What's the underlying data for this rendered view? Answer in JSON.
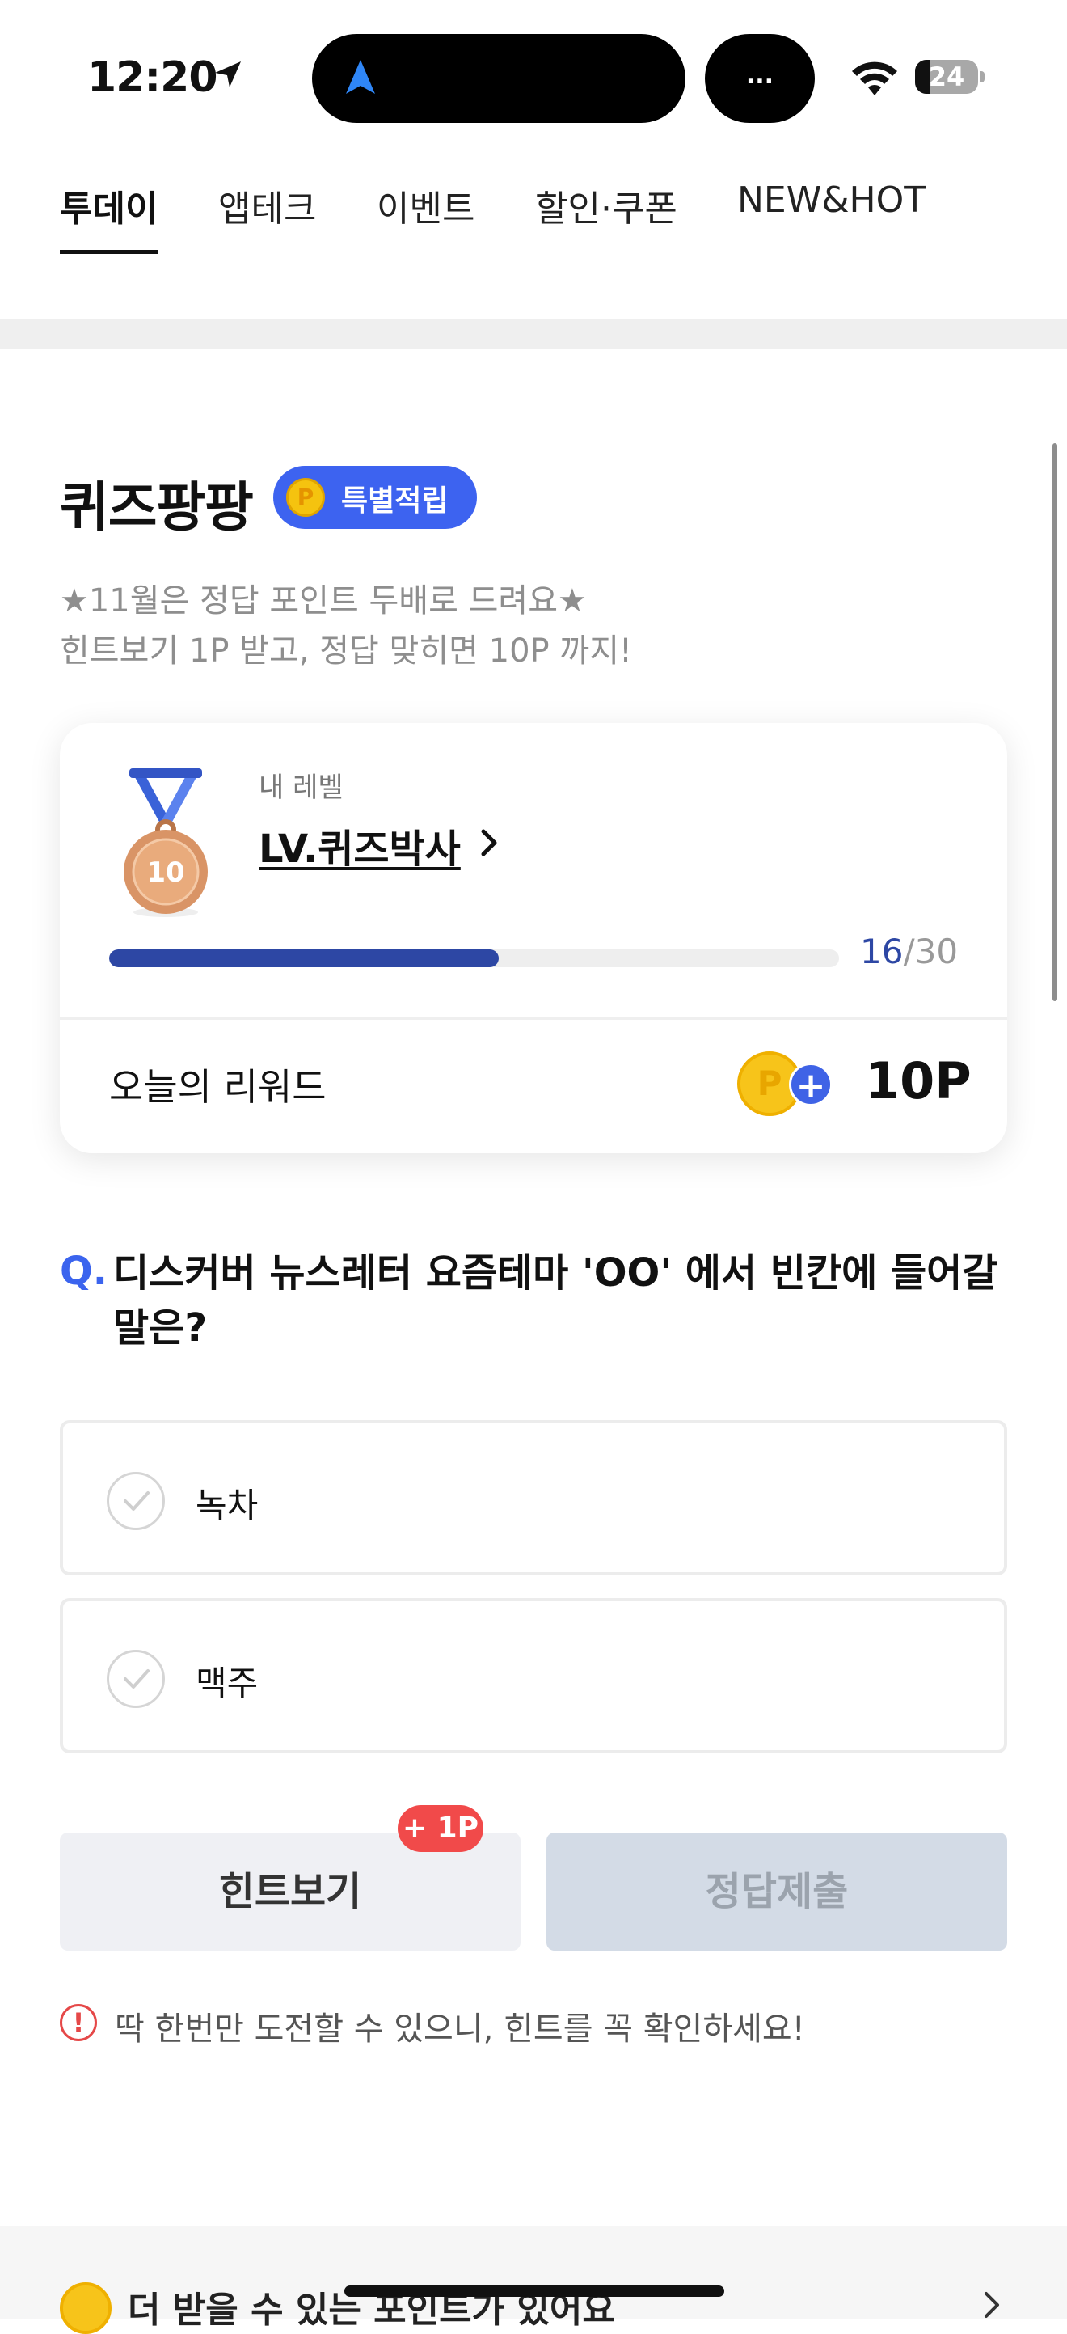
{
  "status_bar": {
    "time": "12:20",
    "island_right_label": "...",
    "battery_level": "24",
    "battery_fraction": 0.24
  },
  "tabs": [
    {
      "label": "투데이",
      "active": true
    },
    {
      "label": "앱테크",
      "active": false
    },
    {
      "label": "이벤트",
      "active": false
    },
    {
      "label": "할인·쿠폰",
      "active": false
    },
    {
      "label": "NEW&HOT",
      "active": false
    }
  ],
  "quiz": {
    "title": "퀴즈팡팡",
    "badge_coin": "P",
    "badge_label": "특별적립",
    "subtitle_line1": "★11월은 정답 포인트 두배로 드려요★",
    "subtitle_line2": "힌트보기 1P 받고, 정답 맞히면 10P 까지!"
  },
  "level_card": {
    "medal_number": "10",
    "label": "내 레벨",
    "level_name": "LV.퀴즈박사",
    "progress_current": "16",
    "progress_separator": "/",
    "progress_total": "30",
    "progress_fraction": 0.5333,
    "reward_label": "오늘의 리워드",
    "reward_coin": "P",
    "reward_plus": "+",
    "reward_value": "10P"
  },
  "question": {
    "marker": "Q.",
    "text": "디스커버 뉴스레터 요즘테마 'OO' 에서 빈칸에 들어갈 말은?",
    "options": [
      {
        "label": "녹차"
      },
      {
        "label": "맥주"
      }
    ]
  },
  "actions": {
    "hint_label": "힌트보기",
    "hint_badge": "+ 1P",
    "submit_label": "정답제출",
    "warning_icon": "!",
    "warning_text": "딱 한번만 도전할 수 있으니, 힌트를 꼭 확인하세요!"
  },
  "bottom_banner": {
    "text": "더 받을 수 있는 포인트가 있어요"
  },
  "colors": {
    "accent_blue": "#3d63f0",
    "progress_blue": "#2d47a4",
    "hint_badge_red": "#f14a4a",
    "coin_yellow": "#f7c41a"
  },
  "icons": [
    "location-arrow-icon",
    "navigation-icon",
    "wifi-icon",
    "battery-icon",
    "medal-icon",
    "chevron-right-icon",
    "coin-icon",
    "plus-icon",
    "check-icon",
    "warning-icon"
  ]
}
